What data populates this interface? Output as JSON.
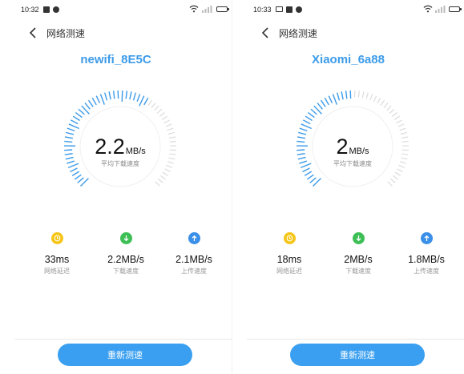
{
  "colors": {
    "accent": "#3d9be9",
    "gauge_active": "#3d9be9",
    "gauge_inactive": "#dcdcdc",
    "latency_icon": "#f5c518",
    "download_icon": "#3dbf55",
    "upload_icon": "#3a8fe8",
    "button_bg": "#3a9ff0"
  },
  "screens": [
    {
      "status_bar": {
        "time": "10:32",
        "left_icons": [
          "square-notification-icon",
          "circle-notification-icon"
        ],
        "right_icons": [
          "wifi-icon",
          "signal-icon",
          "battery-icon"
        ]
      },
      "nav": {
        "back_icon": "chevron-left-icon",
        "title": "网络测速"
      },
      "network_name": "newifi_8E5C",
      "gauge": {
        "level": 0.62
      },
      "speed": {
        "value": "2.2",
        "unit": "MB/s",
        "label": "平均下载速度"
      },
      "metrics": [
        {
          "icon": "clock-icon",
          "value": "33ms",
          "label": "网络延迟"
        },
        {
          "icon": "download-arrow-icon",
          "value": "2.2MB/s",
          "label": "下载速度"
        },
        {
          "icon": "upload-arrow-icon",
          "value": "2.1MB/s",
          "label": "上传速度"
        }
      ],
      "button": {
        "label": "重新测速"
      }
    },
    {
      "status_bar": {
        "time": "10:33",
        "left_icons": [
          "image-notification-icon",
          "square-notification-icon",
          "circle-notification-icon"
        ],
        "right_icons": [
          "wifi-icon",
          "signal-icon",
          "battery-icon"
        ]
      },
      "nav": {
        "back_icon": "chevron-left-icon",
        "title": "网络测速"
      },
      "network_name": "Xiaomi_6a88",
      "gauge": {
        "level": 0.5
      },
      "speed": {
        "value": "2",
        "unit": "MB/s",
        "label": "平均下载速度"
      },
      "metrics": [
        {
          "icon": "clock-icon",
          "value": "18ms",
          "label": "网络延迟"
        },
        {
          "icon": "download-arrow-icon",
          "value": "2MB/s",
          "label": "下载速度"
        },
        {
          "icon": "upload-arrow-icon",
          "value": "1.8MB/s",
          "label": "上传速度"
        }
      ],
      "button": {
        "label": "重新测速"
      }
    }
  ]
}
